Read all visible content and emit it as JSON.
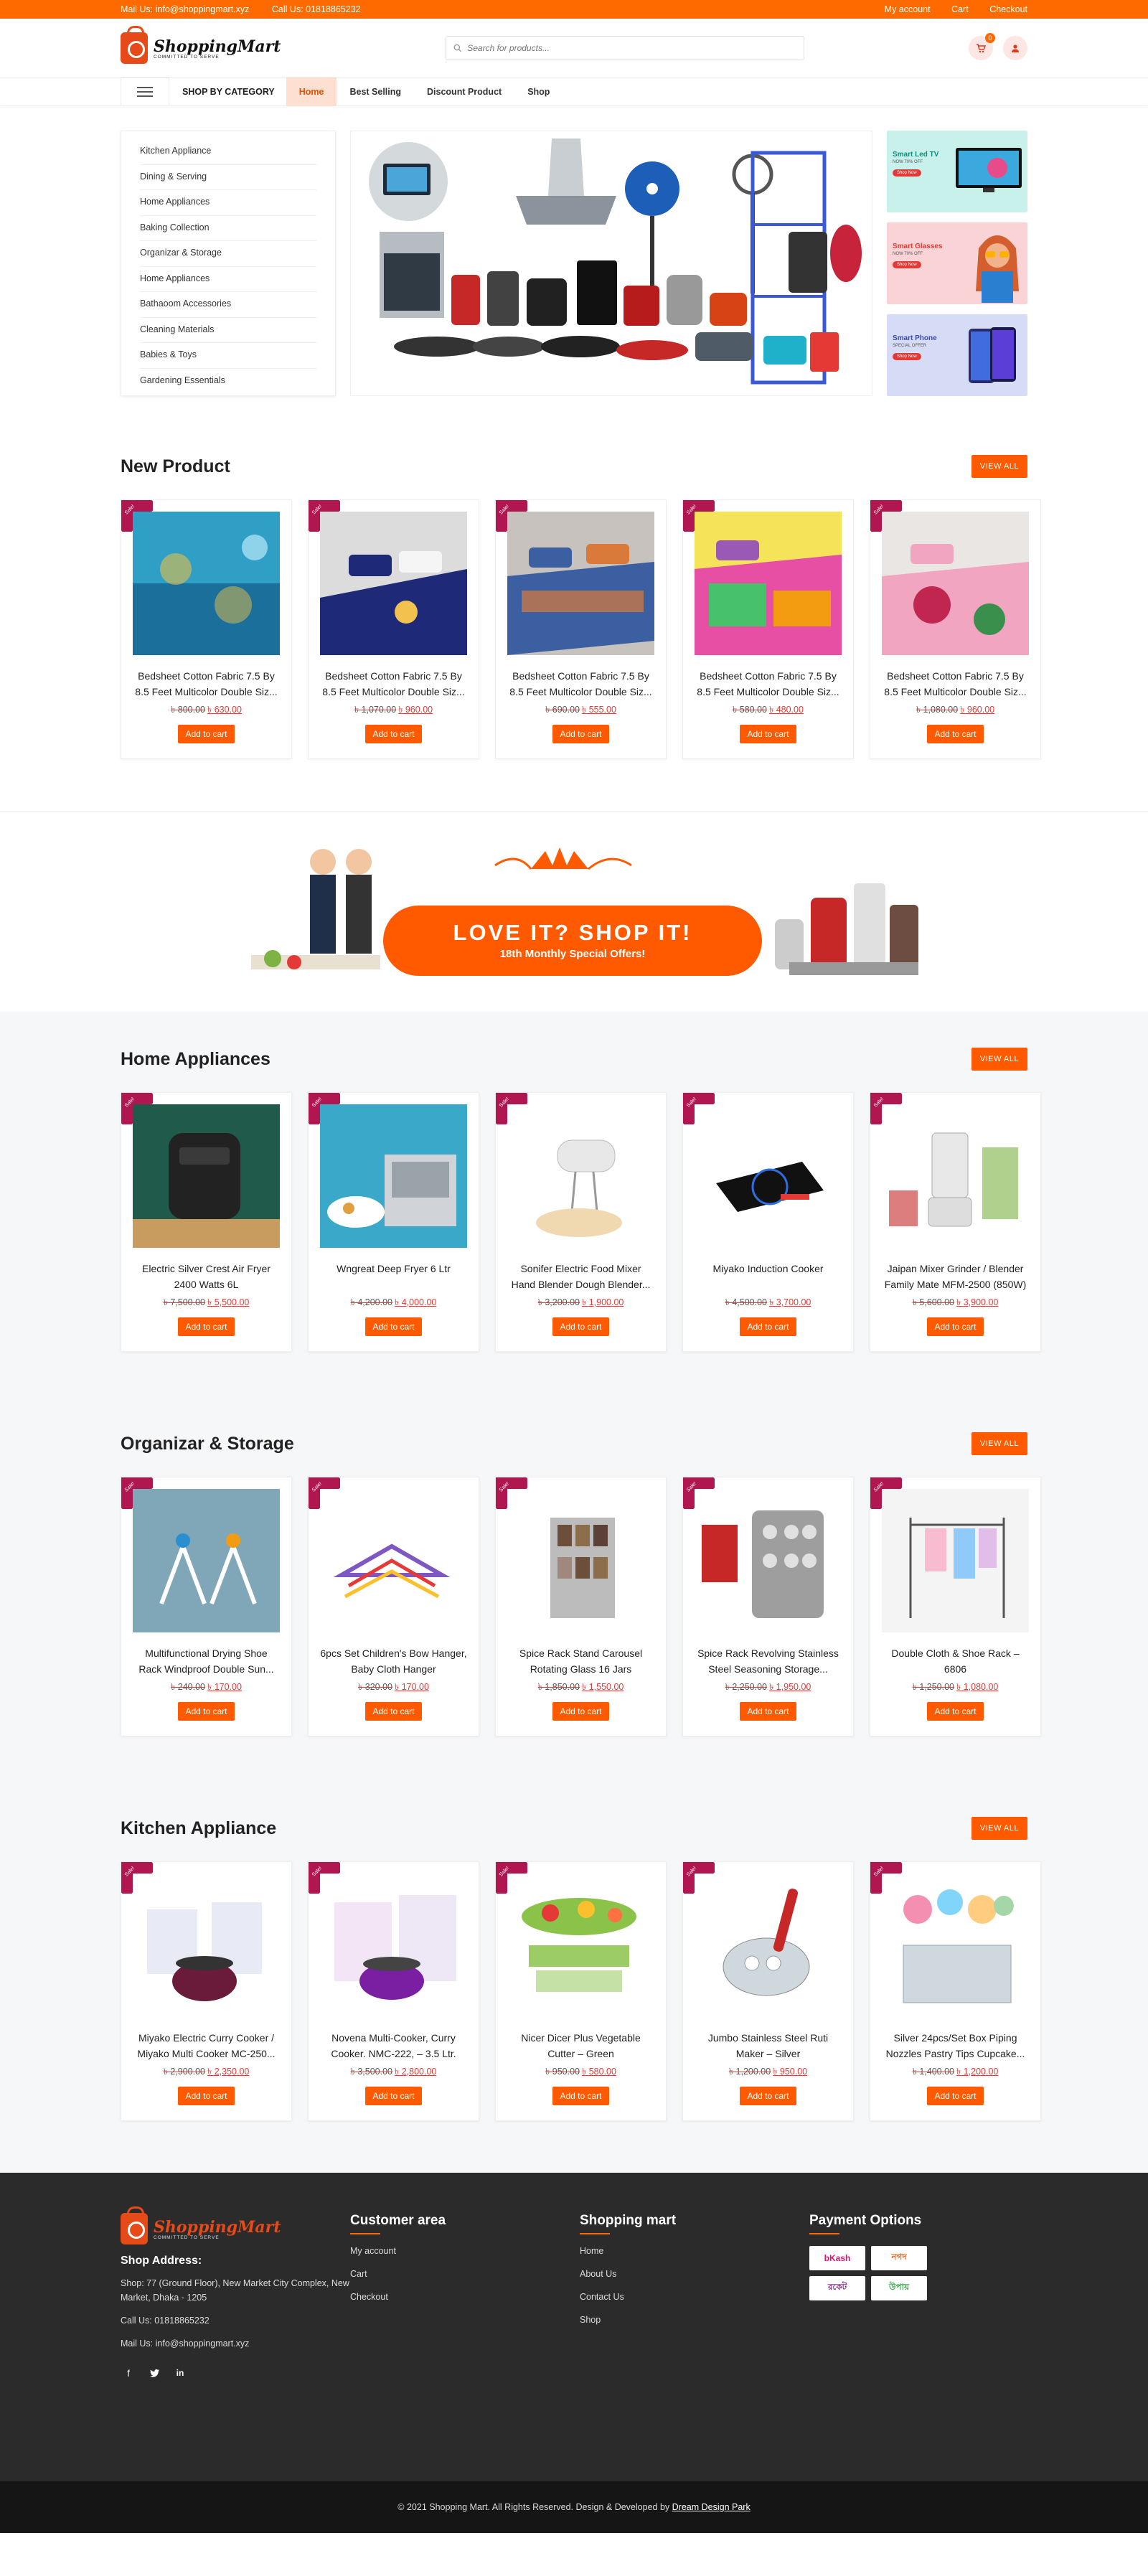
{
  "topbar": {
    "mail": "Mail Us: info@shoppingmart.xyz",
    "call": "Call Us: 01818865232",
    "links": [
      "My account",
      "Cart",
      "Checkout"
    ]
  },
  "header": {
    "logo_name": "ShoppingMart",
    "logo_tag": "COMMITTED TO SERVE",
    "search_placeholder": "Search for products...",
    "cart_count": "0"
  },
  "nav": {
    "category_label": "SHOP BY CATEGORY",
    "items": [
      "Home",
      "Best Selling",
      "Discount Product",
      "Shop"
    ]
  },
  "sidebar": [
    "Kitchen Appliance",
    "Dining & Serving",
    "Home Appliances",
    "Baking Collection",
    "Organizar & Storage",
    "Home Appliances",
    "Bathaoom Accessories",
    "Cleaning Materials",
    "Babies & Toys",
    "Gardening Essentials"
  ],
  "promos": [
    {
      "title": "Smart Led TV",
      "sub": "NOW 70% OFF",
      "btn": "Shop Now",
      "bg": "#c9f1ec"
    },
    {
      "title": "Smart Glasses",
      "sub": "NOW 70% OFF",
      "btn": "Shop Now",
      "bg": "#f9d3d6"
    },
    {
      "title": "Smart Phone",
      "sub": "SPECIAL OFFER",
      "btn": "Shop Now",
      "bg": "#d7dcf6"
    }
  ],
  "sale_label": "Sale!",
  "add_to_cart": "Add to cart",
  "view_all": "VIEW ALL",
  "sections": [
    {
      "title": "New Product",
      "products": [
        {
          "name": "Bedsheet Cotton Fabric 7.5 By 8.5 Feet Multicolor Double Siz...",
          "old": "৳ 800.00",
          "new": "৳ 630.00"
        },
        {
          "name": "Bedsheet Cotton Fabric 7.5 By 8.5 Feet Multicolor Double Siz...",
          "old": "৳ 1,070.00",
          "new": "৳ 960.00"
        },
        {
          "name": "Bedsheet Cotton Fabric 7.5 By 8.5 Feet Multicolor Double Siz...",
          "old": "৳ 690.00",
          "new": "৳ 555.00"
        },
        {
          "name": "Bedsheet Cotton Fabric 7.5 By 8.5 Feet Multicolor Double Siz...",
          "old": "৳ 580.00",
          "new": "৳ 480.00"
        },
        {
          "name": "Bedsheet Cotton Fabric 7.5 By 8.5 Feet Multicolor Double Siz...",
          "old": "৳ 1,080.00",
          "new": "৳ 960.00"
        }
      ]
    },
    {
      "title": "Home Appliances",
      "products": [
        {
          "name": "Electric Silver Crest Air Fryer 2400 Watts 6L",
          "old": "৳ 7,500.00",
          "new": "৳ 5,500.00"
        },
        {
          "name": "Wngreat Deep Fryer 6 Ltr",
          "old": "৳ 4,200.00",
          "new": "৳ 4,000.00"
        },
        {
          "name": "Sonifer Electric Food Mixer Hand Blender Dough Blender...",
          "old": "৳ 3,200.00",
          "new": "৳ 1,900.00"
        },
        {
          "name": "Miyako Induction Cooker",
          "old": "৳ 4,500.00",
          "new": "৳ 3,700.00"
        },
        {
          "name": "Jaipan Mixer Grinder / Blender Family Mate MFM-2500 (850W)",
          "old": "৳ 5,600.00",
          "new": "৳ 3,900.00"
        }
      ]
    },
    {
      "title": "Organizar & Storage",
      "products": [
        {
          "name": "Multifunctional Drying Shoe Rack Windproof Double Sun...",
          "old": "৳ 240.00",
          "new": "৳ 170.00"
        },
        {
          "name": "6pcs Set Children's Bow Hanger, Baby Cloth Hanger",
          "old": "৳ 320.00",
          "new": "৳ 170.00"
        },
        {
          "name": "Spice Rack Stand Carousel Rotating Glass 16 Jars",
          "old": "৳ 1,850.00",
          "new": "৳ 1,550.00"
        },
        {
          "name": "Spice Rack Revolving Stainless Steel Seasoning Storage...",
          "old": "৳ 2,250.00",
          "new": "৳ 1,950.00"
        },
        {
          "name": "Double Cloth & Shoe Rack – 6806",
          "old": "৳ 1,250.00",
          "new": "৳ 1,080.00"
        }
      ]
    },
    {
      "title": "Kitchen Appliance",
      "products": [
        {
          "name": "Miyako Electric Curry Cooker / Miyako Multi Cooker MC-250...",
          "old": "৳ 2,900.00",
          "new": "৳ 2,350.00"
        },
        {
          "name": "Novena Multi-Cooker, Curry Cooker. NMC-222, – 3.5 Ltr.",
          "old": "৳ 3,500.00",
          "new": "৳ 2,800.00"
        },
        {
          "name": "Nicer Dicer Plus Vegetable Cutter – Green",
          "old": "৳ 950.00",
          "new": "৳ 580.00"
        },
        {
          "name": "Jumbo Stainless Steel Ruti Maker – Silver",
          "old": "৳ 1,200.00",
          "new": "৳ 950.00"
        },
        {
          "name": "Silver 24pcs/Set Box Piping Nozzles Pastry Tips Cupcake...",
          "old": "৳ 1,400.00",
          "new": "৳ 1,200.00"
        }
      ]
    }
  ],
  "strip": {
    "headline": "LOVE IT? SHOP IT!",
    "sub": "18th Monthly Special Offers!"
  },
  "footer": {
    "address_title": "Shop Address:",
    "address": "Shop: 77 (Ground Floor), New Market City Complex, New Market, Dhaka - 1205",
    "call": "Call Us: 01818865232",
    "mail": "Mail Us: info@shoppingmart.xyz",
    "customer_title": "Customer area",
    "customer_links": [
      "My account",
      "Cart",
      "Checkout"
    ],
    "mart_title": "Shopping mart",
    "mart_links": [
      "Home",
      "About Us",
      "Contact Us",
      "Shop"
    ],
    "pay_title": "Payment Options",
    "pays": [
      "bKash",
      "নগদ",
      "রকেট",
      "উপায়"
    ],
    "copyright": "© 2021 Shopping Mart. All Rights Reserved. Design & Developed by",
    "dev": "Dream Design Park"
  },
  "colors": {
    "accent": "#ff6a00",
    "sale": "#b0164f",
    "price": "#e53935",
    "footer": "#2b2b2b"
  }
}
